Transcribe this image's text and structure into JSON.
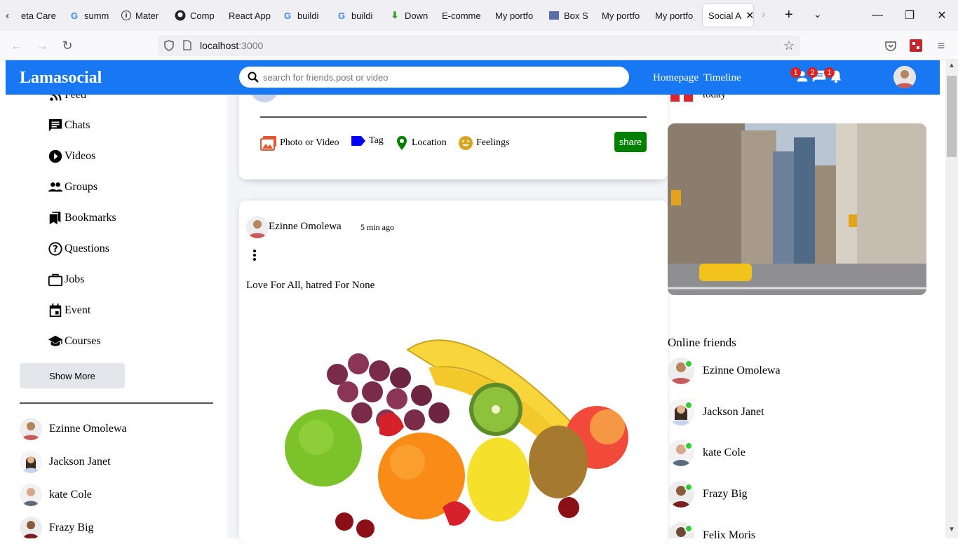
{
  "browser": {
    "tabs": [
      {
        "label": "eta Care",
        "icon": "page-icon"
      },
      {
        "label": "summ",
        "icon": "google-icon"
      },
      {
        "label": "Mater",
        "icon": "info-icon"
      },
      {
        "label": "Comp",
        "icon": "github-icon"
      },
      {
        "label": "React App",
        "icon": "none"
      },
      {
        "label": "buildi",
        "icon": "google-icon"
      },
      {
        "label": "buildi",
        "icon": "google-icon"
      },
      {
        "label": "Down",
        "icon": "download-icon"
      },
      {
        "label": "E-comme",
        "icon": "none"
      },
      {
        "label": "My portfo",
        "icon": "none"
      },
      {
        "label": "Box Sl",
        "icon": "box-icon"
      },
      {
        "label": "My portfo",
        "icon": "none"
      },
      {
        "label": "My portfo",
        "icon": "none"
      },
      {
        "label": "Social A",
        "icon": "none",
        "active": true
      }
    ],
    "url_host": "localhost",
    "url_port": ":3000"
  },
  "app": {
    "logo": "Lamasocial",
    "search_placeholder": "search for friends,post or video",
    "links": {
      "homepage": "Homepage",
      "timeline": "Timeline"
    },
    "badges": {
      "friends": "1",
      "messages": "2",
      "notifications": "1"
    },
    "accent": "#1877f2"
  },
  "sidebar": {
    "items": [
      {
        "label": "Feed",
        "icon": "rss-feed-icon"
      },
      {
        "label": "Chats",
        "icon": "chat-icon"
      },
      {
        "label": "Videos",
        "icon": "play-circle-icon"
      },
      {
        "label": "Groups",
        "icon": "group-icon"
      },
      {
        "label": "Bookmarks",
        "icon": "bookmark-icon"
      },
      {
        "label": "Questions",
        "icon": "help-circle-icon"
      },
      {
        "label": "Jobs",
        "icon": "briefcase-icon"
      },
      {
        "label": "Event",
        "icon": "calendar-icon"
      },
      {
        "label": "Courses",
        "icon": "school-icon"
      }
    ],
    "show_more": "Show More",
    "friends": [
      "Ezinne Omolewa",
      "Jackson Janet",
      "kate Cole",
      "Frazy Big"
    ]
  },
  "share": {
    "options": [
      {
        "label": "Photo or Video",
        "icon": "photo-icon",
        "color": "#e4572e"
      },
      {
        "label": "Tag",
        "icon": "label-icon",
        "color": "#0000ff"
      },
      {
        "label": "Location",
        "icon": "location-icon",
        "color": "#008000"
      },
      {
        "label": "Feelings",
        "icon": "emoji-icon",
        "color": "#daa520"
      }
    ],
    "button": "share"
  },
  "post": {
    "author": "Ezinne Omolewa",
    "time": "5 min ago",
    "text": "Love For All, hatred For None"
  },
  "rightbar": {
    "birthday_text": "today",
    "online_title": "Online friends",
    "online": [
      "Ezinne Omolewa",
      "Jackson Janet",
      "kate Cole",
      "Frazy Big",
      "Felix Moris"
    ]
  }
}
